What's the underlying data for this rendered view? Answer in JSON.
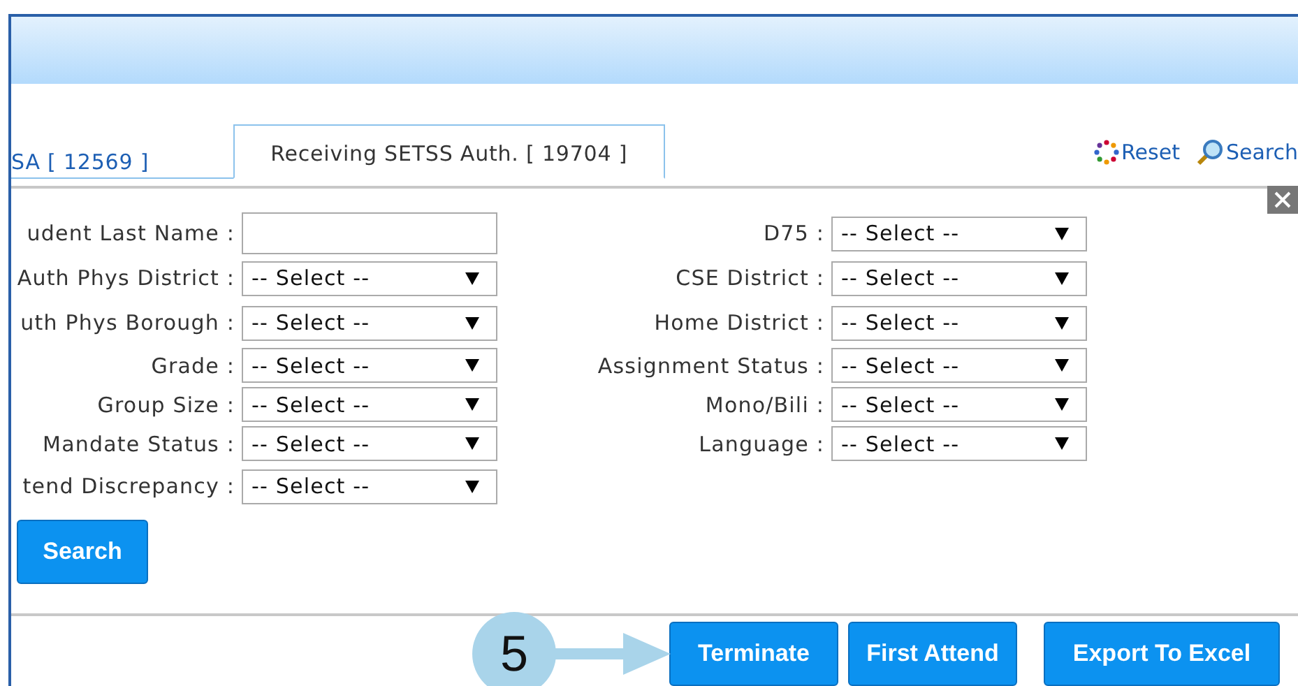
{
  "tabs": [
    {
      "label": "SA [ 12569  ]",
      "selected": false
    },
    {
      "label": "Receiving SETSS Auth. [ 19704 ]",
      "selected": true
    }
  ],
  "toolbar": [
    {
      "label": "Reset",
      "kind": "reset"
    },
    {
      "label": "Search",
      "kind": "search"
    }
  ],
  "left_fields": [
    {
      "label": "udent Last Name :",
      "kind": "text"
    },
    {
      "label": "Auth Phys District :",
      "kind": "select",
      "value": "-- Select --"
    },
    {
      "label": "uth Phys Borough :",
      "kind": "select",
      "value": "-- Select --"
    },
    {
      "label": "Grade :",
      "kind": "select",
      "value": "-- Select --"
    },
    {
      "label": "Group Size :",
      "kind": "select",
      "value": "-- Select --"
    },
    {
      "label": "Mandate Status :",
      "kind": "select",
      "value": "-- Select --"
    },
    {
      "label": "tend Discrepancy :",
      "kind": "select",
      "value": "-- Select --"
    }
  ],
  "right_fields": [
    {
      "label": "D75 :",
      "kind": "select",
      "value": "-- Select --"
    },
    {
      "label": "CSE District :",
      "kind": "select",
      "value": "-- Select --"
    },
    {
      "label": "Home District :",
      "kind": "select",
      "value": "-- Select --"
    },
    {
      "label": "Assignment Status :",
      "kind": "select",
      "value": "-- Select --"
    },
    {
      "label": "Mono/Bili :",
      "kind": "select",
      "value": "-- Select --"
    },
    {
      "label": "Language :",
      "kind": "select",
      "value": "-- Select --"
    }
  ],
  "search_button": "Search",
  "callout": "5",
  "actions": [
    "Terminate",
    "First Attend",
    "Export To Excel"
  ]
}
